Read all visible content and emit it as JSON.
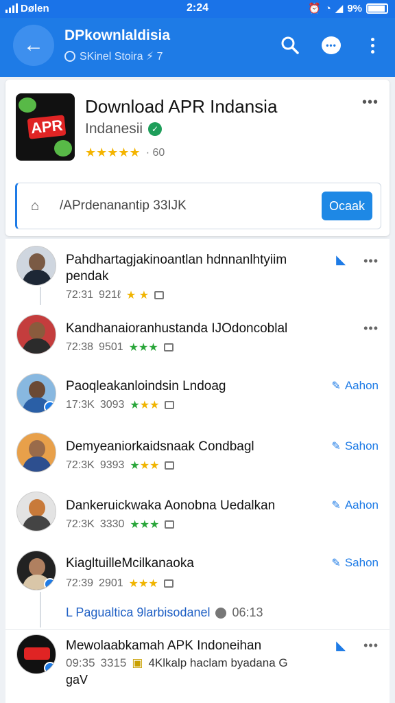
{
  "status_bar": {
    "carrier": "Dølen",
    "time": "2:24",
    "battery": "9%"
  },
  "app_bar": {
    "title": "DPkownlaldisia",
    "subtitle": "SKinel Stoira ⚡ 7"
  },
  "app_card": {
    "title": "Download APR Indansia",
    "developer": "Indanesii",
    "stars": "★★★★★",
    "rating_count": "· 60",
    "search_text": "/APrdenanantip  33IJK",
    "ok_label": "Ocaak",
    "icon_text": "APR"
  },
  "feed": {
    "items": [
      {
        "name": "Pahdhartagjakinoantlan hdnnanlhtyiim",
        "name2": "pendak",
        "time": "72:31",
        "count": "921ℓ",
        "stars": "★ ★",
        "star_color": "yellow",
        "action": ""
      },
      {
        "name": "Kandhanaioranhustanda IJOdoncoblal",
        "time": "72:38",
        "count": "9501",
        "stars": "★★★",
        "star_color": "green",
        "action": ""
      },
      {
        "name": "Paoqleakanloindsin Lndoag",
        "time": "17:3K",
        "count": "3093",
        "stars": "★★★",
        "star_color": "mixed",
        "action": "Aahon"
      },
      {
        "name": "Demyeaniorkaidsnaak Condbagl",
        "time": "72:3K",
        "count": "9393",
        "stars": "★★★",
        "star_color": "mixed",
        "action": "Sahon"
      },
      {
        "name": "Dankeruickwaka Aonobna Uedalkan",
        "time": "72:3K",
        "count": "3330",
        "stars": "★★★",
        "star_color": "green",
        "action": "Aahon"
      },
      {
        "name": "KiagltuilleMcilkanaoka",
        "time": "72:39",
        "count": "2901",
        "stars": "★★★",
        "star_color": "mixed",
        "action": "Sahon"
      },
      {
        "name": "Mewolaabkamah APK Indoneihan",
        "name2": "gaV",
        "time": "09:35",
        "count": "3315",
        "extra": "4Klkalp haclam byadana G",
        "action": ""
      }
    ],
    "thread_link": "L Pagualtica 9larbisodanel",
    "thread_link_time": "06:13"
  }
}
